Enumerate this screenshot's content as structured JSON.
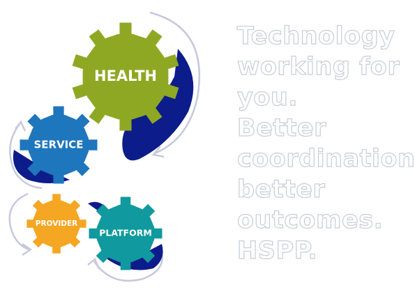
{
  "gears": [
    {
      "id": "health",
      "label": "HEALTH",
      "color": "#8fa823",
      "shadow": "#0c1c8a"
    },
    {
      "id": "service",
      "label": "SERVICE",
      "color": "#1e76bd",
      "shadow": "#0c1c8a"
    },
    {
      "id": "provider",
      "label": "PROVIDER",
      "color": "#f5a623",
      "shadow": "#0c1c8a"
    },
    {
      "id": "platform",
      "label": "PLATFORM",
      "color": "#10999e",
      "shadow": "#0c1c8a"
    }
  ],
  "tagline": {
    "lines": [
      "Technology",
      "working for",
      "you.",
      "Better",
      "coordination",
      "better",
      "outcomes.",
      "HSPP."
    ]
  },
  "colors": {
    "arrow": "#c6c9de",
    "text_outline": "#c9ccd8"
  }
}
